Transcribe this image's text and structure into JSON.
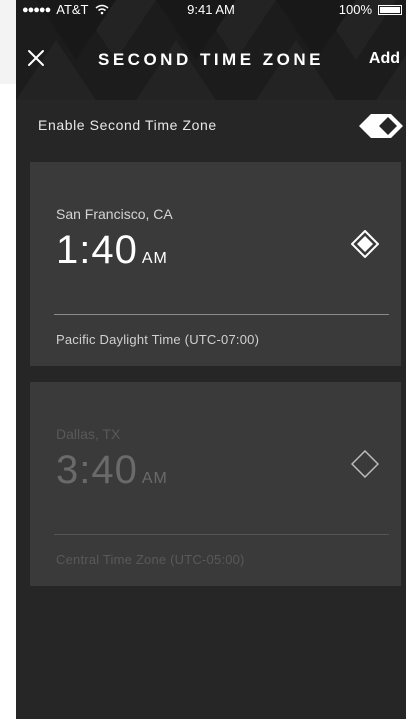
{
  "status_bar": {
    "carrier": "AT&T",
    "time": "9:41 AM",
    "battery": "100%"
  },
  "nav": {
    "title": "SECOND TIME ZONE",
    "add_label": "Add",
    "close_icon": "close-icon"
  },
  "settings": {
    "toggle_label": "Enable Second Time Zone",
    "toggle_on": true
  },
  "time_zones": [
    {
      "city": "San Francisco, CA",
      "time": "1:40",
      "ampm": "AM",
      "zone": "Pacific Daylight Time (UTC-07:00)",
      "selected": true
    },
    {
      "city": "Dallas, TX",
      "time": "3:40",
      "ampm": "AM",
      "zone": "Central Time Zone (UTC-05:00)",
      "selected": false
    }
  ],
  "colors": {
    "background": "#262626",
    "header": "#1c1c1c",
    "card": "#3a3a3a",
    "text": "#ffffff"
  }
}
